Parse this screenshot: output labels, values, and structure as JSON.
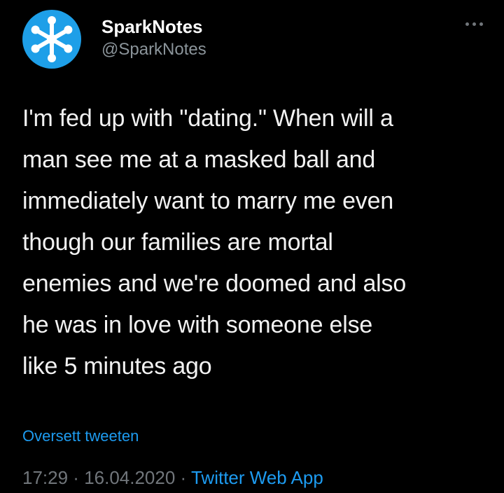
{
  "tweet": {
    "author": {
      "display_name": "SparkNotes",
      "handle": "@SparkNotes",
      "avatar_icon": "sparknotes-logo-icon",
      "avatar_color": "#1e9fe8"
    },
    "more_icon": "more-options-icon",
    "text": "I'm fed up with \"dating.\" When will a\nman see me at a masked ball and\nimmediately want to marry me even\nthough our families are mortal\nenemies and we're doomed and also\nhe was in love with someone else\nlike 5 minutes ago",
    "translate_label": "Oversett tweeten",
    "time": "17:29",
    "separator": " · ",
    "date": "16.04.2020",
    "source": "Twitter Web App"
  },
  "colors": {
    "background": "#000000",
    "text": "#f2f2f2",
    "secondary": "#71767b",
    "link": "#1d9bf0"
  }
}
